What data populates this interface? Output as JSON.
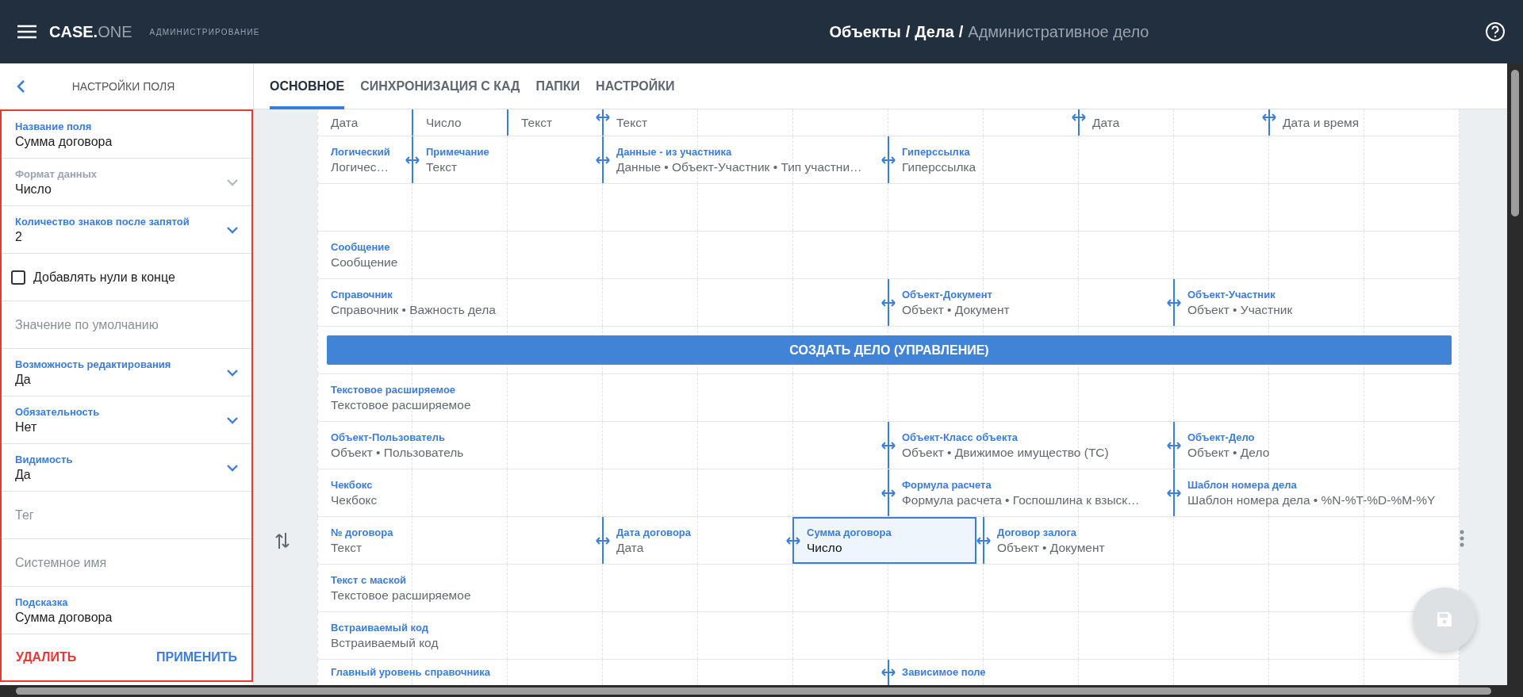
{
  "header": {
    "logo": {
      "main": "CASE.",
      "accent": "ONE"
    },
    "section": "АДМИНИСТРИРОВАНИЕ",
    "separator": "/",
    "breadcrumb": [
      {
        "text": "Объекты",
        "current": false
      },
      {
        "text": "Дела",
        "current": false
      },
      {
        "text": "Административное дело",
        "current": true
      }
    ]
  },
  "panel": {
    "title": "НАСТРОЙКИ ПОЛЯ",
    "fields": [
      {
        "kind": "input",
        "label": "Название поля",
        "value": "Сумма договора"
      },
      {
        "kind": "select",
        "label": "Формат данных",
        "value": "Число",
        "disabled": true
      },
      {
        "kind": "select",
        "label": "Количество знаков после запятой",
        "value": "2",
        "disabled": false
      },
      {
        "kind": "checkbox",
        "label": "Добавлять нули в конце",
        "checked": false
      },
      {
        "kind": "input",
        "placeholder": "Значение по умолчанию"
      },
      {
        "kind": "select",
        "label": "Возможность редактирования",
        "value": "Да",
        "disabled": false
      },
      {
        "kind": "select",
        "label": "Обязательность",
        "value": "Нет",
        "disabled": false
      },
      {
        "kind": "select",
        "label": "Видимость",
        "value": "Да",
        "disabled": false
      },
      {
        "kind": "input",
        "placeholder": "Тег"
      },
      {
        "kind": "input",
        "placeholder": "Системное имя"
      },
      {
        "kind": "input",
        "label": "Подсказка",
        "value": "Сумма договора"
      }
    ],
    "actions": [
      {
        "label": "УДАЛИТЬ",
        "kind": "danger"
      },
      {
        "label": "ПРИМЕНИТЬ",
        "kind": "primary"
      }
    ]
  },
  "tabs": [
    {
      "label": "ОСНОВНОЕ",
      "selected": true
    },
    {
      "label": "СИНХРОНИЗАЦИЯ С КАД",
      "selected": false
    },
    {
      "label": "ПАПКИ",
      "selected": false
    },
    {
      "label": "НАСТРОЙКИ",
      "selected": false
    }
  ],
  "layout": {
    "rows": [
      {
        "kind": "top",
        "fields": [
          {
            "kind": "field",
            "value": "Дата",
            "handle": false,
            "selected": false
          },
          {
            "kind": "field",
            "value": "Число",
            "handle": false,
            "selected": false
          },
          {
            "kind": "field",
            "value": "Текст",
            "handle": false,
            "selected": false
          },
          {
            "kind": "field",
            "value": "Текст",
            "handle": true,
            "selected": false
          },
          {
            "kind": "field",
            "value": "Дата",
            "handle": true,
            "selected": false
          },
          {
            "kind": "field",
            "value": "Дата и время",
            "handle": true,
            "selected": false
          }
        ]
      },
      {
        "kind": "full",
        "fields": [
          {
            "kind": "field",
            "label": "Логический",
            "value": "Логичес…",
            "handle": false,
            "selected": false
          },
          {
            "kind": "field",
            "label": "Примечание",
            "value": "Текст",
            "handle": true,
            "selected": false
          },
          {
            "kind": "field",
            "label": "Данные - из участника",
            "value": "Данные • Объект-Участник • Тип участни…",
            "handle": true,
            "selected": false
          },
          {
            "kind": "field",
            "label": "Гиперссылка",
            "value": "Гиперссылка",
            "handle": true,
            "selected": false
          }
        ]
      },
      {
        "kind": "full",
        "fields": []
      },
      {
        "kind": "full",
        "fields": [
          {
            "kind": "field",
            "label": "Сообщение",
            "value": "Сообщение",
            "handle": false,
            "selected": false
          }
        ]
      },
      {
        "kind": "full",
        "fields": [
          {
            "kind": "field",
            "label": "Справочник",
            "value": "Справочник • Важность дела",
            "handle": false,
            "selected": false
          },
          {
            "kind": "field",
            "label": "Объект-Документ",
            "value": "Объект • Документ",
            "handle": true,
            "selected": false
          },
          {
            "kind": "field",
            "label": "Объект-Участник",
            "value": "Объект • Участник",
            "handle": true,
            "selected": false
          }
        ]
      },
      {
        "kind": "full",
        "fields": [
          {
            "kind": "button",
            "label": "СОЗДАТЬ ДЕЛО (УПРАВЛЕНИЕ)",
            "selected": false
          }
        ]
      },
      {
        "kind": "full",
        "fields": [
          {
            "kind": "field",
            "label": "Текстовое расширяемое",
            "value": "Текстовое расширяемое",
            "handle": false,
            "selected": false
          }
        ]
      },
      {
        "kind": "full",
        "fields": [
          {
            "kind": "field",
            "label": "Объект-Пользователь",
            "value": "Объект • Пользователь",
            "handle": false,
            "selected": false
          },
          {
            "kind": "field",
            "label": "Объект-Класс объекта",
            "value": "Объект • Движимое имущество (ТС)",
            "handle": true,
            "selected": false
          },
          {
            "kind": "field",
            "label": "Объект-Дело",
            "value": "Объект • Дело",
            "handle": true,
            "selected": false
          }
        ]
      },
      {
        "kind": "full",
        "fields": [
          {
            "kind": "field",
            "label": "Чекбокс",
            "value": "Чекбокс",
            "handle": false,
            "selected": false
          },
          {
            "kind": "field",
            "label": "Формула расчета",
            "value": "Формула расчета • Госпошлина к взыск…",
            "handle": true,
            "selected": false
          },
          {
            "kind": "field",
            "label": "Шаблон номера дела",
            "value": "Шаблон номера дела • %N-%T-%D-%M-%Y",
            "handle": true,
            "selected": false
          }
        ]
      },
      {
        "kind": "full",
        "fields": [
          {
            "kind": "field",
            "label": "№ договора",
            "value": "Текст",
            "handle": false,
            "selected": false
          },
          {
            "kind": "field",
            "label": "Дата договора",
            "value": "Дата",
            "handle": true,
            "selected": false
          },
          {
            "kind": "field",
            "label": "Сумма договора",
            "value": "Число",
            "handle": true,
            "selected": true
          },
          {
            "kind": "field",
            "label": "Договор залога",
            "value": "Объект • Документ",
            "handle": true,
            "selected": false
          }
        ]
      },
      {
        "kind": "full",
        "fields": [
          {
            "kind": "field",
            "label": "Текст с маской",
            "value": "Текстовое расширяемое",
            "handle": false,
            "selected": false
          }
        ]
      },
      {
        "kind": "full",
        "fields": [
          {
            "kind": "field",
            "label": "Встраиваемый код",
            "value": "Встраиваемый код",
            "handle": false,
            "selected": false
          }
        ]
      },
      {
        "kind": "bottom",
        "fields": [
          {
            "kind": "field",
            "label": "Главный уровень справочника",
            "handle": false,
            "selected": false
          },
          {
            "kind": "field",
            "label": "Зависимое поле",
            "handle": true,
            "selected": false
          }
        ]
      }
    ]
  }
}
